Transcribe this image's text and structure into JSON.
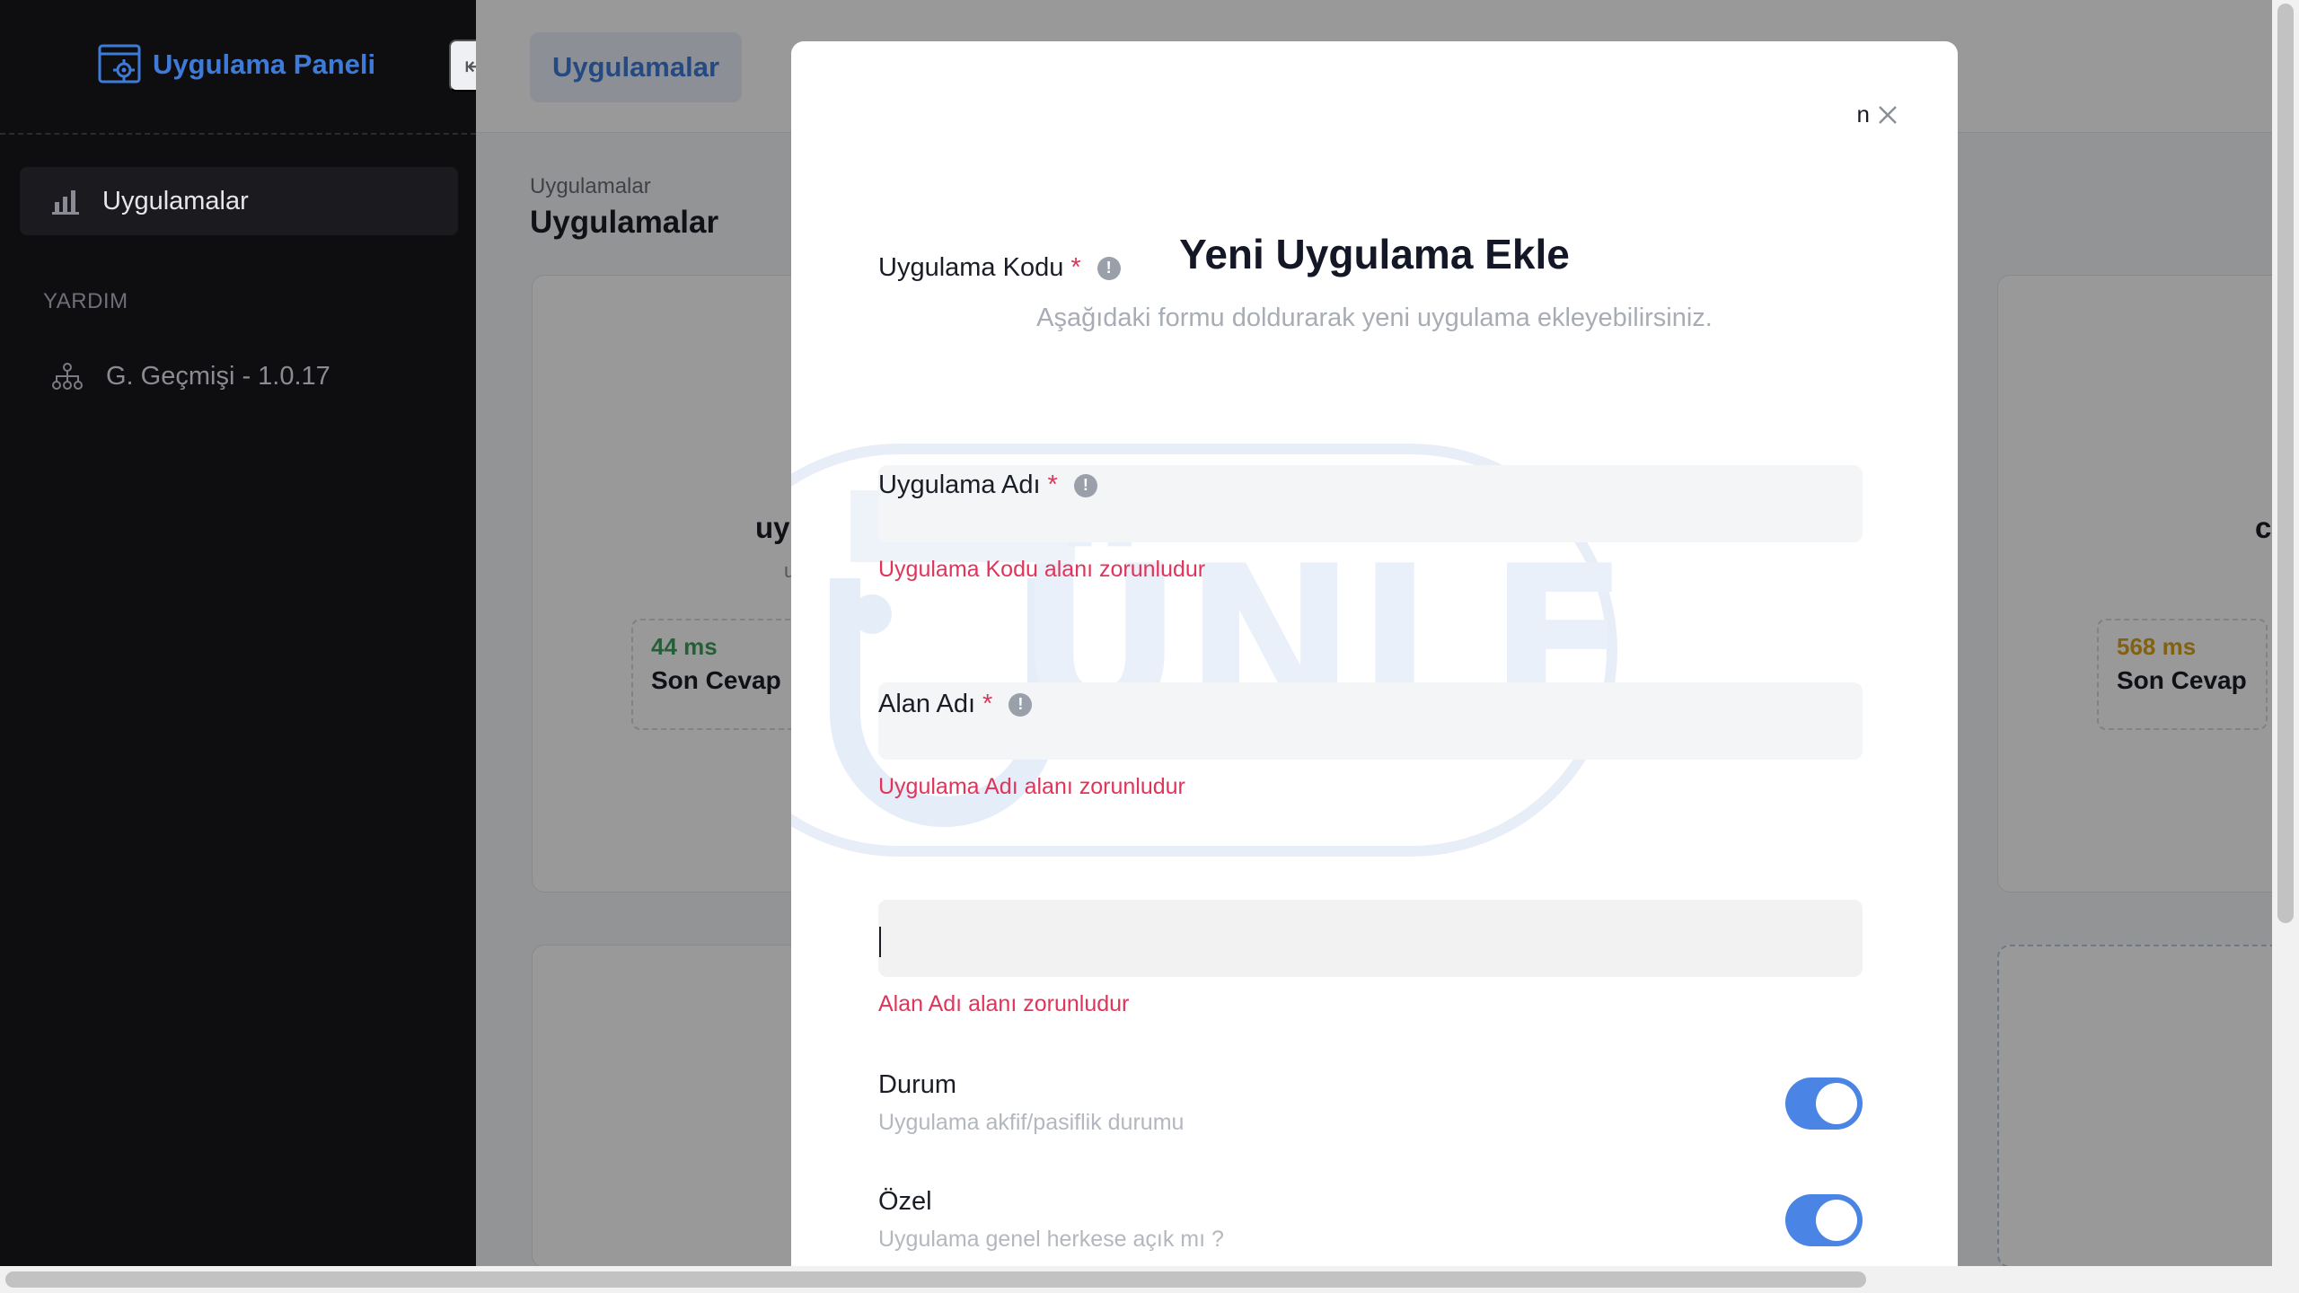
{
  "sidebar": {
    "brand_title": "Uygulama Paneli",
    "active_item": "Uygulamalar",
    "section_label": "YARDIM",
    "help_item": "G. Geçmişi - 1.0.17",
    "collapse_icon": "arrow-left-icon"
  },
  "topbar": {
    "tab_label": "Uygulamalar"
  },
  "page": {
    "breadcrumb": "Uygulamalar",
    "title": "Uygulamalar"
  },
  "cards": [
    {
      "title_fragment": "uy",
      "sub_fragment": "u",
      "stat_value": "44 ms",
      "stat_label": "Son Cevap",
      "stat_color": "#3f9f5d"
    },
    {
      "title_fragment": "c",
      "stat_value": "568 ms",
      "stat_label": "Son Cevap",
      "stat_color": "#d9a21b"
    }
  ],
  "modal": {
    "close_label": "n",
    "title": "Yeni Uygulama Ekle",
    "subtitle": "Aşağıdaki formu doldurarak yeni uygulama ekleyebilirsiniz.",
    "fields": [
      {
        "label": "Uygulama Kodu",
        "required": "*",
        "info": "!",
        "value": "",
        "error": "Uygulama Kodu alanı zorunludur"
      },
      {
        "label": "Uygulama Adı",
        "required": "*",
        "info": "!",
        "value": "",
        "error": "Uygulama Adı alanı zorunludur"
      },
      {
        "label": "Alan Adı",
        "required": "*",
        "info": "!",
        "value": "",
        "error": "Alan Adı alanı zorunludur"
      }
    ],
    "toggles": [
      {
        "title": "Durum",
        "description": "Uygulama akfif/pasiflik durumu",
        "on": true
      },
      {
        "title": "Özel",
        "description": "Uygulama genel herkese açık mı ?",
        "on": true
      }
    ],
    "watermark_text": "ÜNLEM"
  },
  "colors": {
    "accent": "#3e7bd8",
    "error": "#e0345a",
    "toggle_on": "#4a84e4",
    "sidebar_bg": "#0e0e11"
  }
}
